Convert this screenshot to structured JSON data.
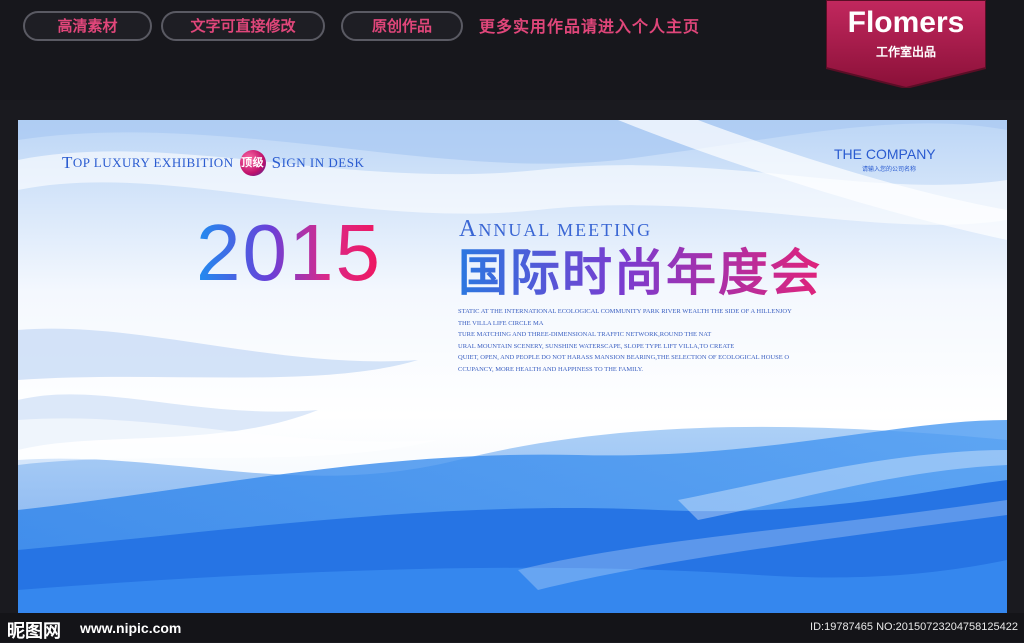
{
  "topbar": {
    "pills": [
      "高清素材",
      "文字可直接修改",
      "原创作品"
    ],
    "promo": "更多实用作品请进入个人主页",
    "brand_title": "Flomers",
    "brand_sub": "工作室出品"
  },
  "banner": {
    "tagline_part1_cap": "T",
    "tagline_part1": "OP LUXURY EXHIBITION",
    "badge": "顶级",
    "tagline_part2_cap": "S",
    "tagline_part2": "IGN IN DESK",
    "company": "THE COMPANY",
    "company_sub": "请输入您的公司名称",
    "year": "2015",
    "annual_cap": "A",
    "annual_rest": "NNUAL  MEETING",
    "title_cn": "国际时尚年度会",
    "description_lines": [
      "STATIC AT THE INTERNATIONAL ECOLOGICAL COMMUNITY PARK RIVER WEALTH THE SIDE OF A HILLENJOY",
      "THE VILLA LIFE CIRCLE MA",
      "TURE MATCHING AND THREE-DIMENSIONAL TRAFFIC NETWORK,ROUND THE NAT",
      "URAL MOUNTAIN SCENERY, SUNSHINE WATERSCAPE, SLOPE TYPE LIFT VILLA,TO CREATE",
      "QUIET, OPEN, AND PEOPLE DO NOT HARASS MANSION BEARING,THE SELECTION OF ECOLOGICAL HOUSE O",
      "CCUPANCY, MORE HEALTH AND HAPPINESS TO THE FAMILY."
    ]
  },
  "footer": {
    "watermark": "昵图网",
    "url": "www.nipic.com",
    "image_id": "ID:19787465 NO:20150723204758125422"
  },
  "colors": {
    "accent_pink": "#e0467a",
    "banner_blue": "#2a5bd0",
    "wave_blue": "#2a7fe6"
  }
}
